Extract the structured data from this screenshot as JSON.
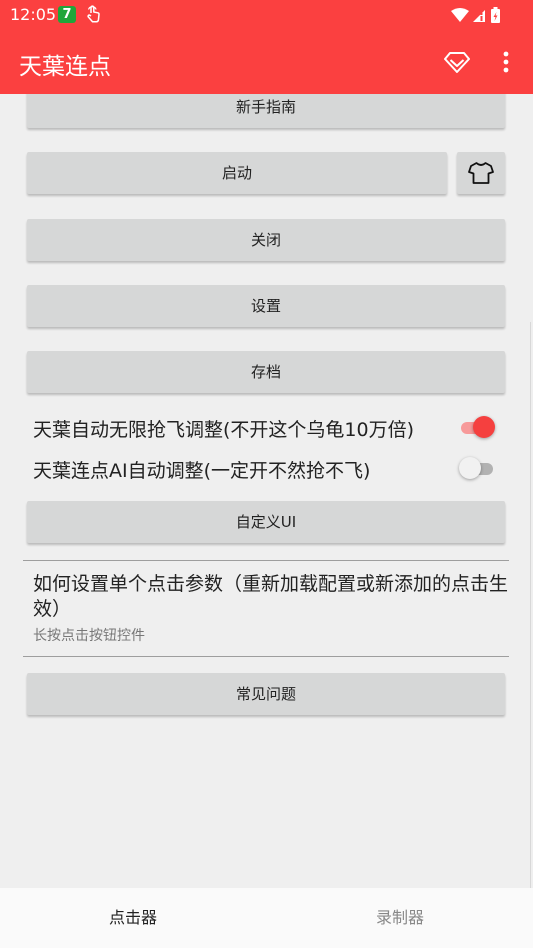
{
  "status_bar": {
    "time": "12:05",
    "notif_badge": "7",
    "icons": [
      "touch-icon",
      "wifi-icon",
      "signal-icon",
      "battery-icon"
    ]
  },
  "app_bar": {
    "title": "天葉连点",
    "actions": [
      "gem-icon",
      "more-vert-icon"
    ]
  },
  "buttons": {
    "guide": "新手指南",
    "start": "启动",
    "close": "关闭",
    "settings": "设置",
    "save": "存档",
    "custom_ui": "自定义UI",
    "faq": "常见问题"
  },
  "switches": [
    {
      "label": "天葉自动无限抢飞调整(不开这个乌龟10万倍)",
      "on": true
    },
    {
      "label": "天葉连点AI自动调整(一定开不然抢不飞)",
      "on": false
    }
  ],
  "preference": {
    "title": "如何设置单个点击参数（重新加载配置或新添加的点击生效）",
    "summary": "长按点击按钮控件"
  },
  "bottom_nav": [
    {
      "label": "点击器",
      "active": true
    },
    {
      "label": "录制器",
      "active": false
    }
  ],
  "colors": {
    "primary": "#fb4040",
    "switch_on": "#f5403f",
    "button_bg": "#d6d7d7"
  }
}
